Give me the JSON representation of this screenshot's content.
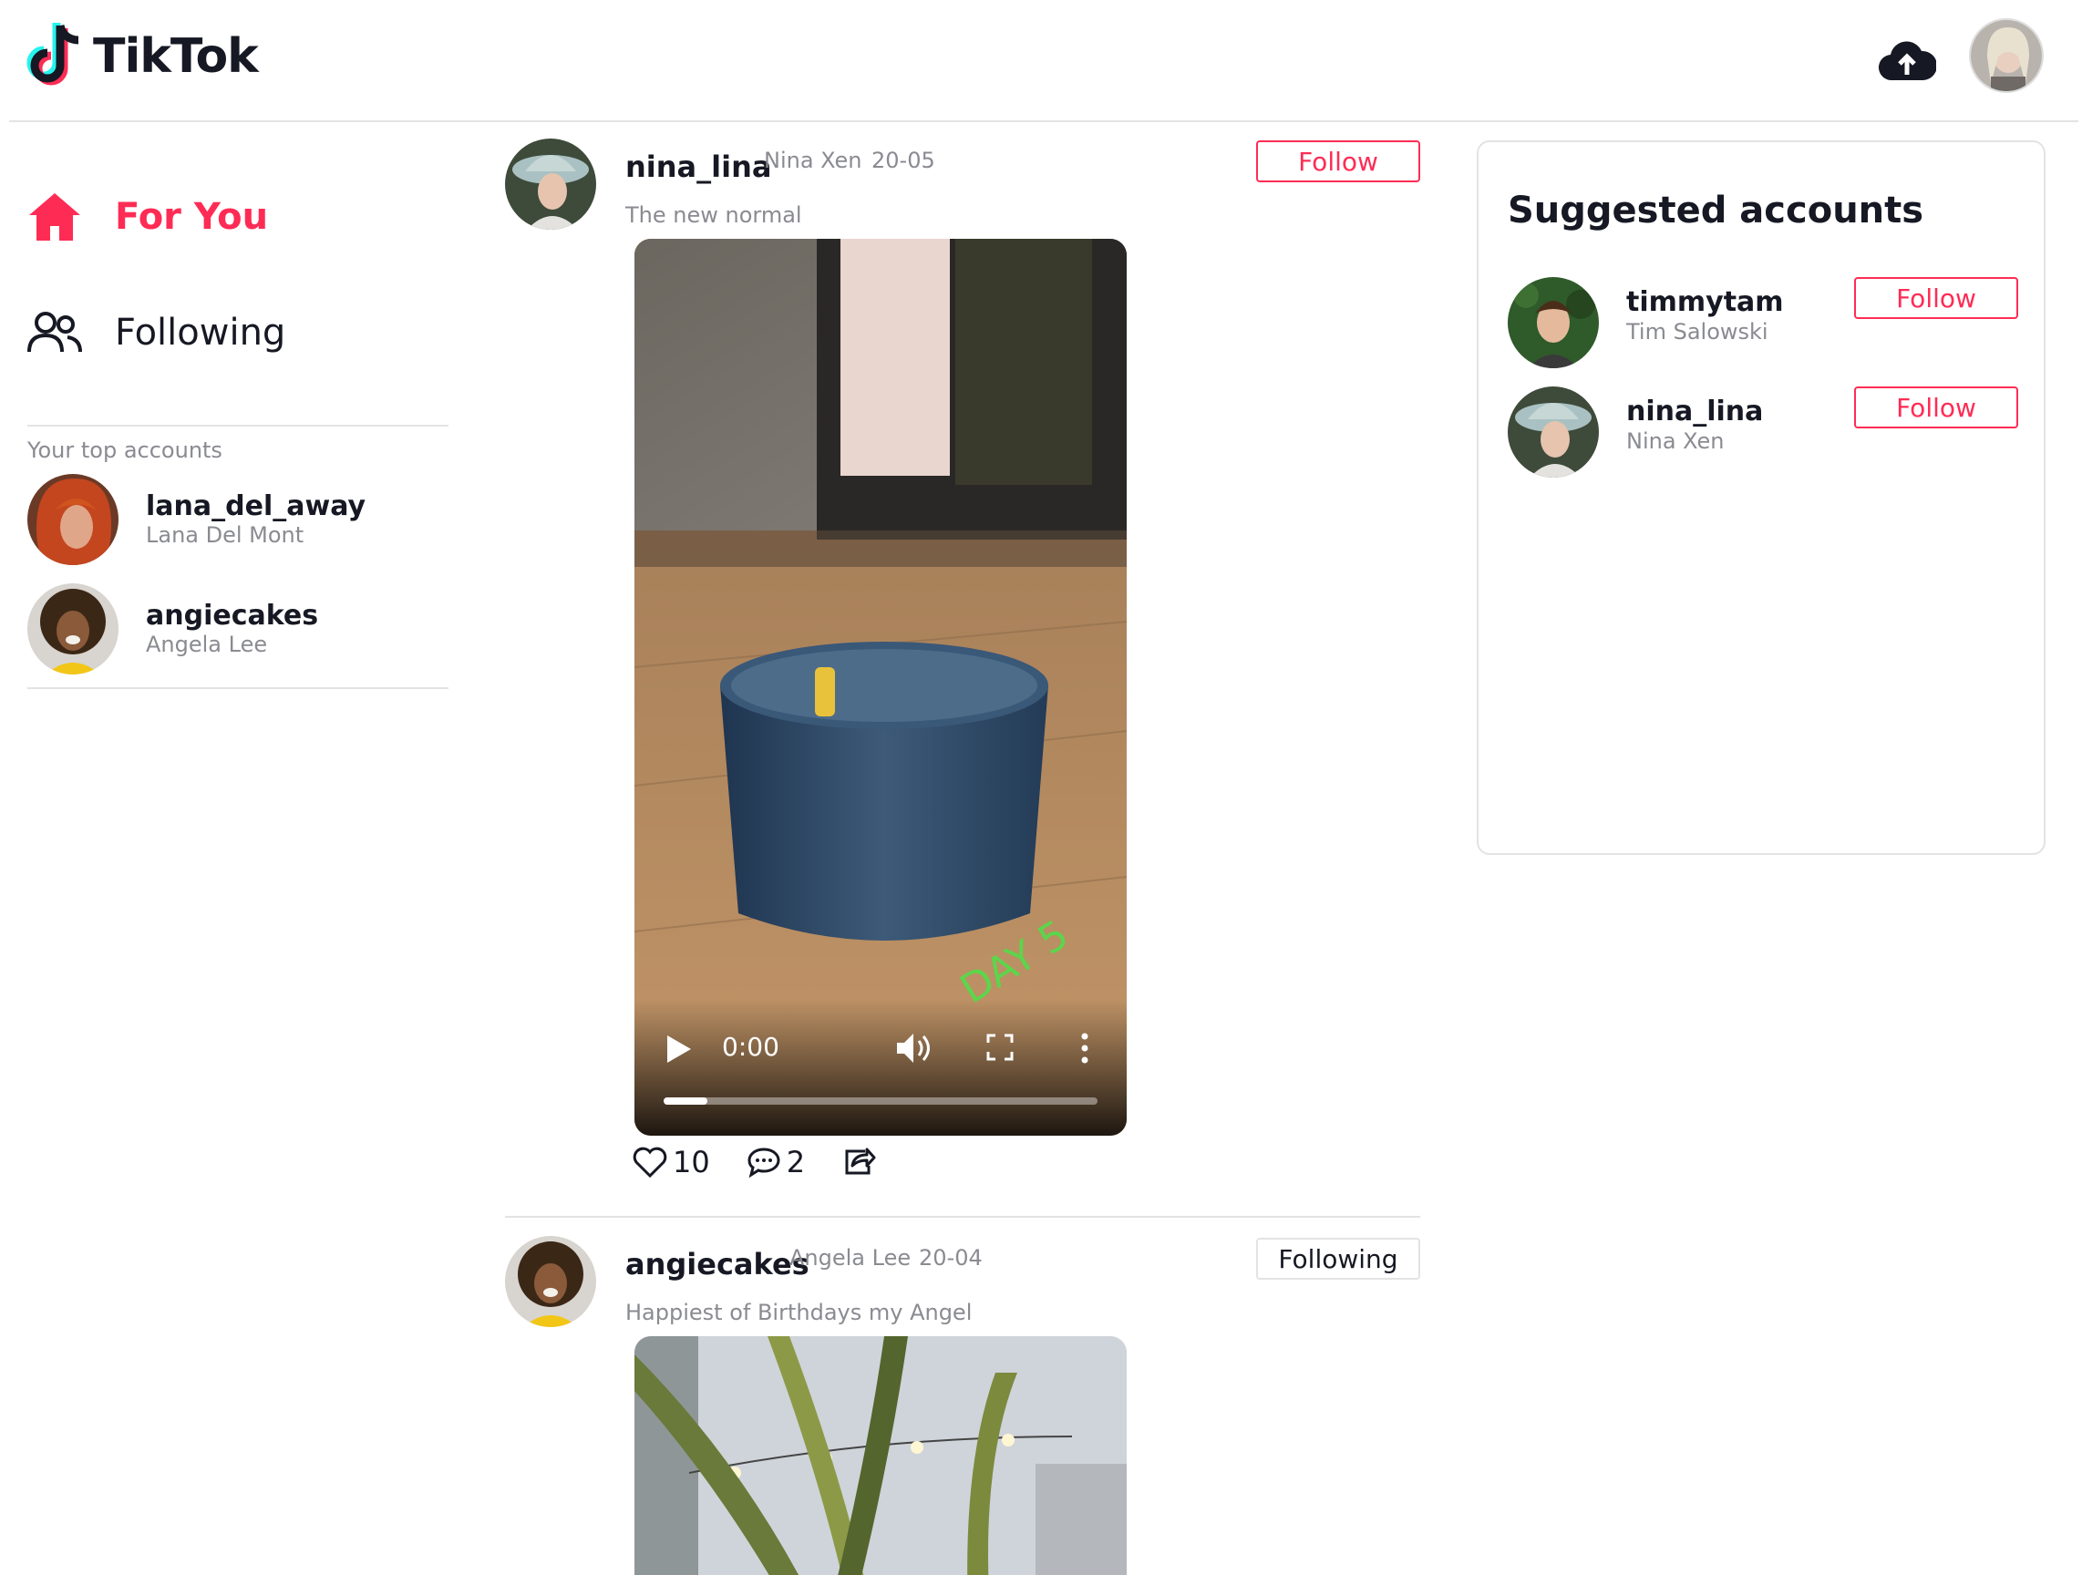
{
  "header": {
    "logo_text": "TikTok",
    "upload_icon": "cloud-upload-icon",
    "avatar_icon": "user-avatar"
  },
  "sidebar": {
    "nav": [
      {
        "label": "For You",
        "icon": "home-icon",
        "active": true
      },
      {
        "label": "Following",
        "icon": "users-icon",
        "active": false
      }
    ],
    "top_accounts_label": "Your top accounts",
    "top_accounts": [
      {
        "username": "lana_del_away",
        "display_name": "Lana Del Mont"
      },
      {
        "username": "angiecakes",
        "display_name": "Angela Lee"
      }
    ]
  },
  "feed": {
    "posts": [
      {
        "username": "nina_lina",
        "display_name": "Nina Xen",
        "date": "20-05",
        "caption": "The new normal",
        "follow_label": "Follow",
        "video": {
          "time": "0:00",
          "progress": 0.1,
          "overlay_text": "DAY 5"
        },
        "likes": "10",
        "comments": "2"
      },
      {
        "username": "angiecakes",
        "display_name": "Angela Lee",
        "date": "20-04",
        "caption": "Happiest of Birthdays my Angel",
        "follow_label": "Following"
      }
    ]
  },
  "suggested": {
    "title": "Suggested accounts",
    "accounts": [
      {
        "username": "timmytam",
        "display_name": "Tim Salowski",
        "follow_label": "Follow"
      },
      {
        "username": "nina_lina",
        "display_name": "Nina Xen",
        "follow_label": "Follow"
      }
    ]
  },
  "colors": {
    "accent": "#fe2c55",
    "text": "#161823",
    "muted": "#8a8b91",
    "divider": "#e3e3e4"
  }
}
